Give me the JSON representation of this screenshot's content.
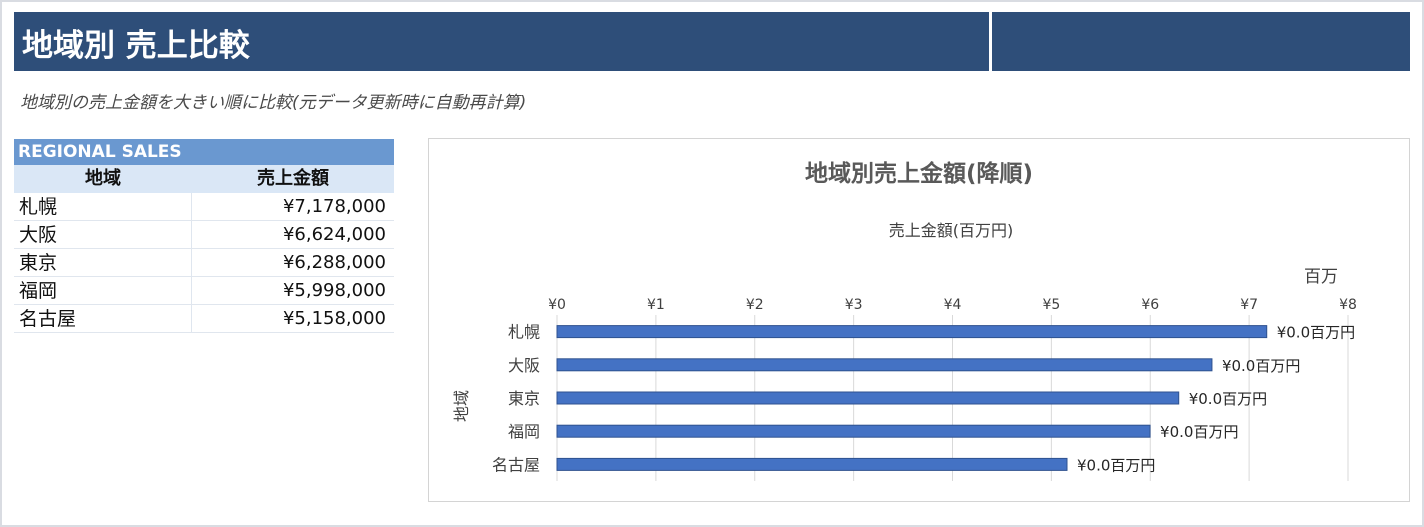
{
  "header": {
    "title": "地域別 売上比較"
  },
  "subtitle": "地域別の売上金額を大きい順に比較(元データ更新時に自動再計算)",
  "table": {
    "caption": "REGIONAL SALES",
    "col_region": "地域",
    "col_amount": "売上金額",
    "rows": [
      {
        "region": "札幌",
        "amount": "¥7,178,000"
      },
      {
        "region": "大阪",
        "amount": "¥6,624,000"
      },
      {
        "region": "東京",
        "amount": "¥6,288,000"
      },
      {
        "region": "福岡",
        "amount": "¥5,998,000"
      },
      {
        "region": "名古屋",
        "amount": "¥5,158,000"
      }
    ]
  },
  "chart_data": {
    "type": "bar",
    "orientation": "horizontal",
    "title": "地域別売上金額(降順)",
    "xlabel": "売上金額(百万円)",
    "ylabel": "地域",
    "unit_label": "百万",
    "categories": [
      "札幌",
      "大阪",
      "東京",
      "福岡",
      "名古屋"
    ],
    "values": [
      7.178,
      6.624,
      6.288,
      5.998,
      5.158
    ],
    "data_labels": [
      "¥0.0百万円",
      "¥0.0百万円",
      "¥0.0百万円",
      "¥0.0百万円",
      "¥0.0百万円"
    ],
    "xlim": [
      0,
      8
    ],
    "xticks": [
      0,
      1,
      2,
      3,
      4,
      5,
      6,
      7,
      8
    ],
    "tick_labels": [
      "¥0",
      "¥1",
      "¥2",
      "¥3",
      "¥4",
      "¥5",
      "¥6",
      "¥7",
      "¥8"
    ],
    "axis_position": "top",
    "grid": true,
    "legend": "none",
    "colors": {
      "bar": "#4472c4",
      "bar_edge": "#2f528f",
      "grid": "#d9d9d9"
    }
  }
}
